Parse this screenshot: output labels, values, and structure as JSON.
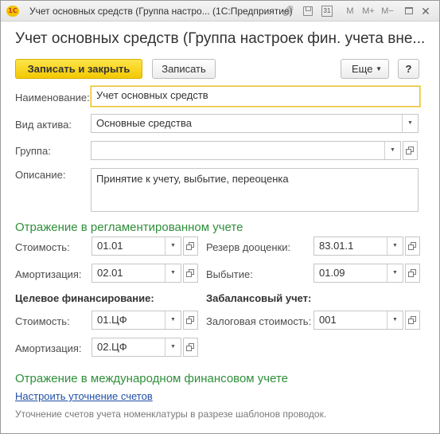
{
  "window": {
    "logo_text": "1С",
    "title": "Учет основных средств (Группа настро... (1С:Предприятие)",
    "buttons": {
      "m": "M",
      "m_plus": "M+",
      "m_minus": "M−",
      "calendar": "31"
    }
  },
  "form": {
    "title": "Учет основных средств (Группа настроек фин. учета вне...",
    "toolbar": {
      "save_close": "Записать и закрыть",
      "save": "Записать",
      "more": "Еще",
      "help": "?"
    },
    "name": {
      "label": "Наименование:",
      "value": "Учет основных средств"
    },
    "asset_type": {
      "label": "Вид актива:",
      "value": "Основные средства"
    },
    "group": {
      "label": "Группа:",
      "value": ""
    },
    "description": {
      "label": "Описание:",
      "value": "Принятие к учету, выбытие, переоценка"
    }
  },
  "regulated": {
    "heading": "Отражение в регламентированном учете",
    "cost": {
      "label": "Стоимость:",
      "value": "01.01"
    },
    "reserve": {
      "label": "Резерв дооценки:",
      "value": "83.01.1"
    },
    "depreciation": {
      "label": "Амортизация:",
      "value": "02.01"
    },
    "disposal": {
      "label": "Выбытие:",
      "value": "01.09"
    },
    "target_financing": {
      "heading": "Целевое финансирование:",
      "cost": {
        "label": "Стоимость:",
        "value": "01.ЦФ"
      },
      "depreciation": {
        "label": "Амортизация:",
        "value": "02.ЦФ"
      }
    },
    "off_balance": {
      "heading": "Забалансовый учет:",
      "collateral": {
        "label": "Залоговая стоимость:",
        "value": "001"
      }
    }
  },
  "international": {
    "heading": "Отражение в международном финансовом учете",
    "link": "Настроить уточнение счетов",
    "note": "Уточнение счетов учета номенклатуры в разрезе шаблонов проводок."
  },
  "colors": {
    "primary_button": "#f2c800",
    "section_heading": "#2f8f3a",
    "link": "#1f4fa8"
  }
}
